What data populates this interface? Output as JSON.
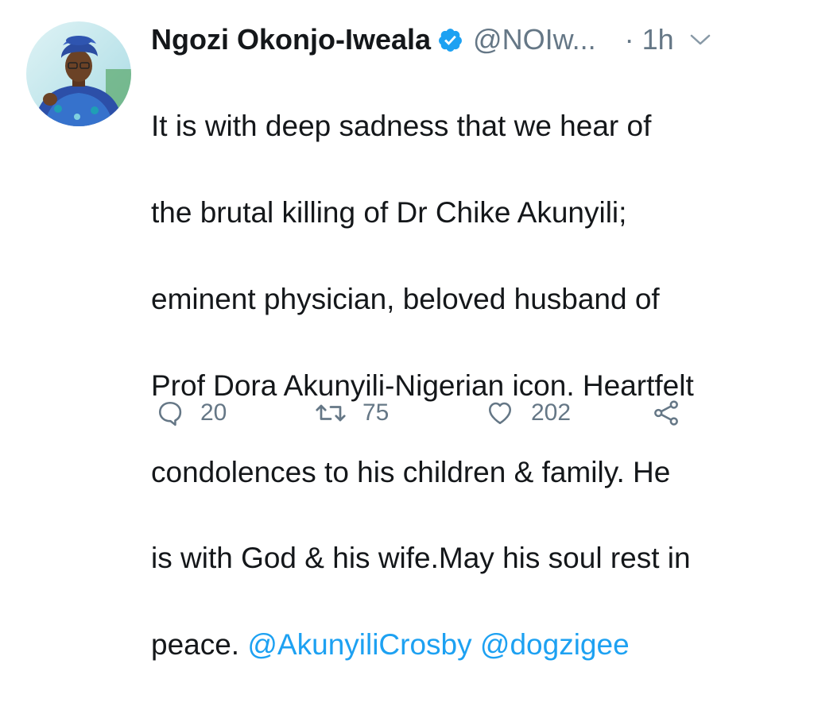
{
  "tweet": {
    "author_name": "Ngozi Okonjo-Iweala",
    "handle": "@NOIw...",
    "time": "· 1h",
    "text_lines": [
      "It is with deep sadness that we hear of",
      "the brutal killing of Dr Chike Akunyili;",
      "eminent physician, beloved husband of",
      "Prof Dora Akunyili-Nigerian icon. Heartfelt",
      "condolences to his children & family. He",
      "is with God & his wife.May his soul rest in",
      "peace. "
    ],
    "mentions": [
      "@AkunyiliCrosby",
      "@dogzigee"
    ]
  },
  "actions": {
    "reply_count": "20",
    "retweet_count": "75",
    "like_count": "202"
  },
  "icons": {
    "verified": "verified-badge-icon",
    "more": "chevron-down-icon",
    "reply": "reply-icon",
    "retweet": "retweet-icon",
    "like": "heart-icon",
    "share": "share-icon"
  },
  "colors": {
    "text": "#14171a",
    "secondary": "#657786",
    "link": "#1da1f2",
    "verified": "#1da1f2"
  }
}
